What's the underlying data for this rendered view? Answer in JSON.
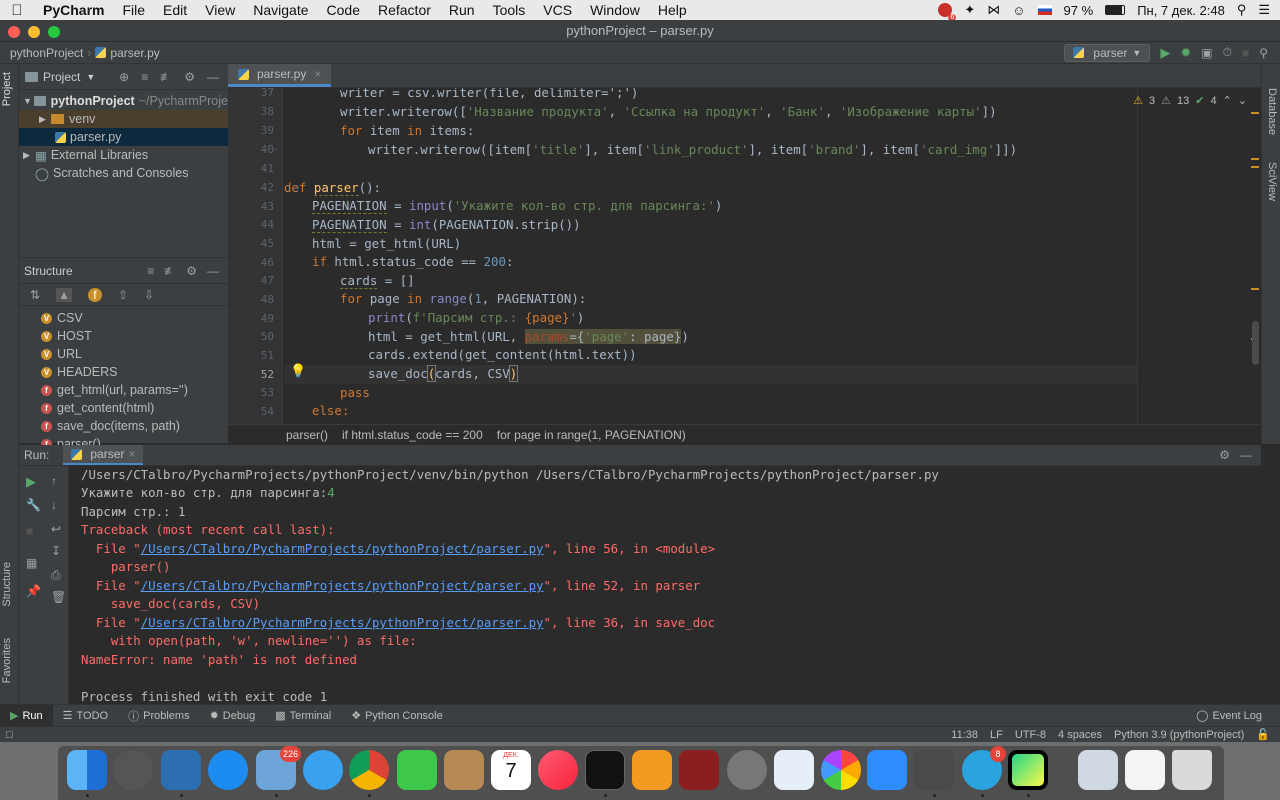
{
  "menubar": {
    "app": "PyCharm",
    "items": [
      "File",
      "Edit",
      "View",
      "Navigate",
      "Code",
      "Refactor",
      "Run",
      "Tools",
      "VCS",
      "Window",
      "Help"
    ],
    "notif_count": "6",
    "battery": "97 %",
    "datetime": "Пн, 7 дек.  2:48"
  },
  "window": {
    "title": "pythonProject – parser.py"
  },
  "navbar": {
    "project": "pythonProject",
    "file": "parser.py",
    "run_config": "parser"
  },
  "sidebar_left": {
    "project_tab": "Project",
    "structure_tab": "Structure",
    "favorites_tab": "Favorites"
  },
  "sidebar_right": {
    "database_tab": "Database",
    "sciview_tab": "SciView"
  },
  "project_panel": {
    "title": "Project",
    "root": "pythonProject",
    "root_path": "~/PycharmProje",
    "items": [
      "venv",
      "parser.py",
      "External Libraries",
      "Scratches and Consoles"
    ]
  },
  "structure_panel": {
    "title": "Structure",
    "items": [
      {
        "badge": "V",
        "label": "CSV"
      },
      {
        "badge": "V",
        "label": "HOST"
      },
      {
        "badge": "V",
        "label": "URL"
      },
      {
        "badge": "V",
        "label": "HEADERS"
      },
      {
        "badge": "f",
        "label": "get_html(url, params='')"
      },
      {
        "badge": "f",
        "label": "get_content(html)"
      },
      {
        "badge": "f",
        "label": "save_doc(items, path)"
      },
      {
        "badge": "f",
        "label": "parser()"
      }
    ]
  },
  "editor": {
    "tab": "parser.py",
    "inspections": {
      "warnings": "3",
      "weak_warnings": "13",
      "typos": "4"
    },
    "line_numbers": [
      "37",
      "38",
      "39",
      "40",
      "41",
      "42",
      "43",
      "44",
      "45",
      "46",
      "47",
      "48",
      "49",
      "50",
      "51",
      "52",
      "53",
      "54"
    ],
    "lines": {
      "l37": "writer = csv.writer(file, delimiter=';')",
      "l38a": "writer.writerow([",
      "l38b": "'Название продукта'",
      "l38c": ", ",
      "l38d": "'Ссылка на продукт'",
      "l38e": ", ",
      "l38f": "'Банк'",
      "l38g": ", ",
      "l38h": "'Изображение карты'",
      "l38i": "])",
      "l39a": "for",
      "l39b": " item ",
      "l39c": "in",
      "l39d": " items:",
      "l40a": "writer.writerow([item[",
      "l40b": "'title'",
      "l40c": "], item[",
      "l40d": "'link_product'",
      "l40e": "], item[",
      "l40f": "'brand'",
      "l40g": "], item[",
      "l40h": "'card_img'",
      "l40i": "]])",
      "l42a": "def",
      "l42b": "parser",
      "l42c": "():",
      "l43a": "PAGENATION",
      "l43b": " = ",
      "l43c": "input",
      "l43d": "(",
      "l43e": "'Укажите кол-во стр. для парсинга:'",
      "l43f": ")",
      "l44a": "PAGENATION",
      "l44b": " = ",
      "l44c": "int",
      "l44d": "(PAGENATION.strip())",
      "l45": "html = get_html(URL)",
      "l46a": "if",
      "l46b": " html.status_code == ",
      "l46c": "200",
      "l46d": ":",
      "l47a": "cards",
      "l47b": " = []",
      "l48a": "for",
      "l48b": " page ",
      "l48c": "in",
      "l48d": " ",
      "l48e": "range",
      "l48f": "(",
      "l48g": "1",
      "l48h": ", PAGENATION):",
      "l49a": "print",
      "l49b": "(",
      "l49c": "f'Парсим стр.: ",
      "l49d": "{page}",
      "l49e": "'",
      "l49f": ")",
      "l50a": "html = get_html(URL, ",
      "l50b": "params",
      "l50c": "={",
      "l50d": "'page'",
      "l50e": ": page}",
      "l50f": ")",
      "l51": "cards.extend(get_content(html.text))",
      "l52a": "save_doc",
      "l52b": "(",
      "l52c": "cards, CSV",
      "l52d": ")",
      "l53": "pass",
      "l54": "else:"
    }
  },
  "breadcrumbs": [
    "parser()",
    "if html.status_code == 200",
    "for page in range(1, PAGENATION)"
  ],
  "run": {
    "label": "Run:",
    "tab": "parser",
    "output": {
      "cmd": "/Users/CTalbro/PycharmProjects/pythonProject/venv/bin/python /Users/CTalbro/PycharmProjects/pythonProject/parser.py",
      "prompt": "Укажите кол-во стр. для парсинга:",
      "input": "4",
      "page": "Парсим стр.: 1",
      "traceback": "Traceback (most recent call last):",
      "file_prefix": "  File \"",
      "path": "/Users/CTalbro/PycharmProjects/pythonProject/parser.py",
      "frame1": "\", line 56, in <module>",
      "code1": "    parser()",
      "frame2": "\", line 52, in parser",
      "code2": "    save_doc(cards, CSV)",
      "frame3": "\", line 36, in save_doc",
      "code3": "    with open(path, 'w', newline='') as file:",
      "error": "NameError: name 'path' is not defined",
      "exit": "Process finished with exit code 1"
    }
  },
  "tool_tabs": {
    "run": "Run",
    "todo": "TODO",
    "problems": "Problems",
    "debug": "Debug",
    "terminal": "Terminal",
    "console": "Python Console",
    "event_log": "Event Log"
  },
  "status": {
    "position": "11:38",
    "line_sep": "LF",
    "encoding": "UTF-8",
    "indent": "4 spaces",
    "interpreter": "Python 3.9 (pythonProject)"
  },
  "dock": {
    "mail_badge": "226",
    "telegram_badge": "8",
    "calendar_month": "ДЕК.",
    "calendar_day": "7"
  }
}
